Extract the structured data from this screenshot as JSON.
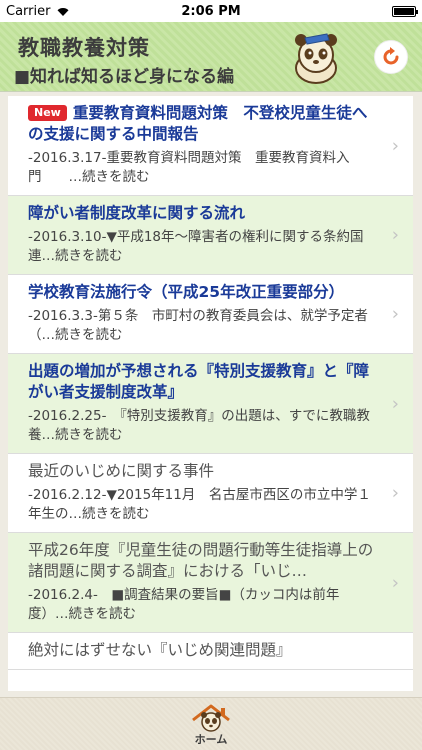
{
  "status_bar": {
    "carrier": "Carrier",
    "time": "2:06 PM"
  },
  "header": {
    "title": "教職教養対策",
    "subtitle": "■知れば知るほど身になる編"
  },
  "badge_new": "New",
  "items": [
    {
      "title": "重要教育資料問題対策　不登校児童生徒への支援に関する中間報告",
      "excerpt": "-2016.3.17-重要教育資料問題対策　重要教育資料入門　　…続きを読む"
    },
    {
      "title": "障がい者制度改革に関する流れ",
      "excerpt": "-2016.3.10-▼平成18年～障害者の権利に関する条約国連…続きを読む"
    },
    {
      "title": "学校教育法施行令（平成25年改正重要部分）",
      "excerpt": "-2016.3.3-第５条　市町村の教育委員会は、就学予定者（…続きを読む"
    },
    {
      "title": "出題の増加が予想される『特別支援教育』と『障がい者支援制度改革』",
      "excerpt": "-2016.2.25-　『特別支援教育』の出題は、すでに教職教養…続きを読む"
    },
    {
      "title": "最近のいじめに関する事件",
      "excerpt": "-2016.2.12-▼2015年11月　名古屋市西区の市立中学１年生の…続きを読む"
    },
    {
      "title": "平成26年度『児童生徒の問題行動等生徒指導上の諸問題に関する調査』における「いじ…",
      "excerpt": "-2016.2.4-　■調査結果の要旨■（カッコ内は前年度）…続きを読む"
    },
    {
      "title": "絶対にはずせない『いじめ関連問題』",
      "excerpt": ""
    }
  ],
  "tab_bar": {
    "home_label": "ホーム"
  },
  "colors": {
    "header_green": "#c9e6a6",
    "link_blue": "#1a3a98",
    "new_red": "#e0282e",
    "row_green": "#e9f5dc"
  }
}
